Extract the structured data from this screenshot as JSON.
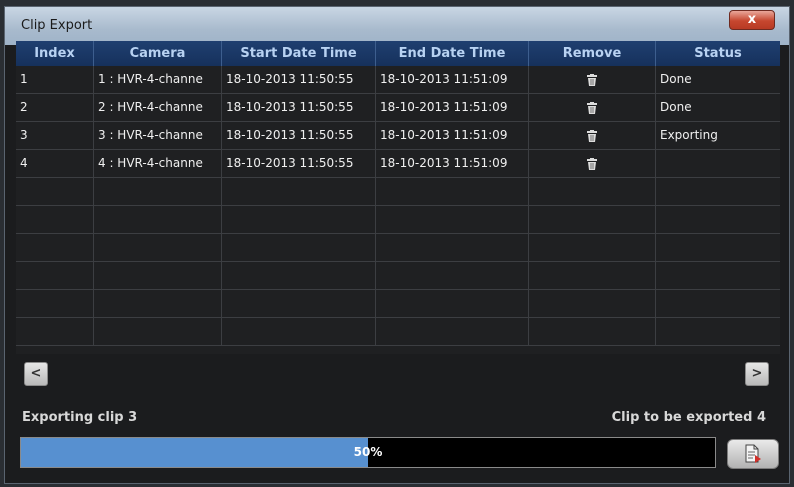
{
  "window": {
    "title": "Clip Export",
    "close_label": "x"
  },
  "table": {
    "headers": [
      "Index",
      "Camera",
      "Start Date Time",
      "End Date Time",
      "Remove",
      "Status"
    ],
    "rows": [
      [
        "1",
        "1 : HVR-4-channe",
        "18-10-2013 11:50:55",
        "18-10-2013 11:51:09",
        "",
        "Done"
      ],
      [
        "2",
        "2 : HVR-4-channe",
        "18-10-2013 11:50:55",
        "18-10-2013 11:51:09",
        "",
        "Done"
      ],
      [
        "3",
        "3 : HVR-4-channe",
        "18-10-2013 11:50:55",
        "18-10-2013 11:51:09",
        "",
        "Exporting"
      ],
      [
        "4",
        "4 : HVR-4-channe",
        "18-10-2013 11:50:55",
        "18-10-2013 11:51:09",
        "",
        ""
      ]
    ],
    "remove_icon": "trash-icon"
  },
  "scroll": {
    "left_label": "<",
    "right_label": ">"
  },
  "status": {
    "left": "Exporting clip 3",
    "right": "Clip to be exported 4"
  },
  "progress": {
    "value": 0.5,
    "label": "50%"
  },
  "export_button": {
    "icon": "export-document-icon"
  },
  "colors": {
    "header": "#1f3f70",
    "progress_fill": "#5790d0",
    "close": "#c6472f"
  }
}
